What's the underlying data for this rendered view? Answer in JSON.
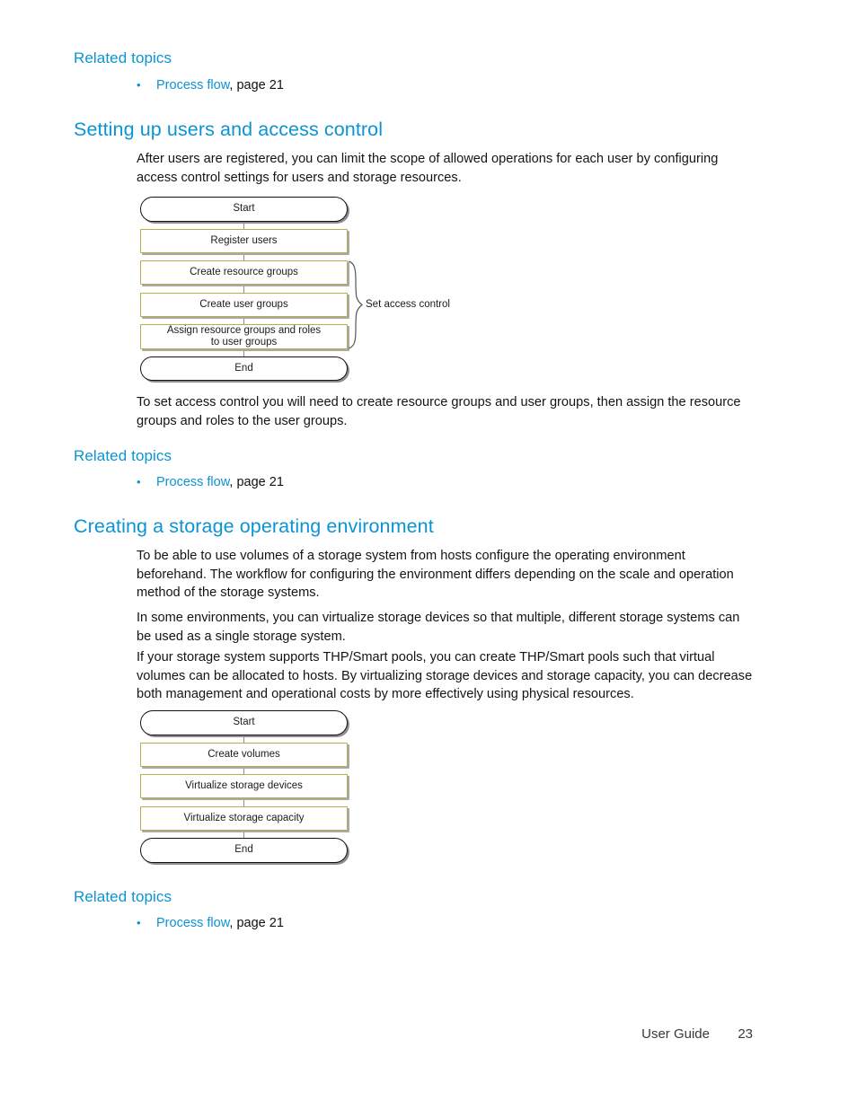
{
  "page": {
    "footer_label": "User Guide",
    "page_number": "23",
    "accent_color": "#0b94d4",
    "step_border_color": "#b5ae49",
    "terminator_border_color": "#111111"
  },
  "related_topics_1": {
    "heading": "Related topics",
    "bullet_marker": "•",
    "link_text": "Process flow",
    "suffix_text": ", page 21"
  },
  "section_access_control": {
    "heading": "Setting up users and access control",
    "intro_paragraph": "After users are registered, you can limit the scope of allowed operations for each user by configuring access control settings for users and storage resources.",
    "closing_paragraph": "To set access control you will need to create resource groups and user groups, then assign the resource groups and roles to the user groups.",
    "diagram": {
      "nodes": [
        {
          "id": "start",
          "label": "Start",
          "type": "terminator"
        },
        {
          "id": "register-users",
          "label": "Register users",
          "type": "step"
        },
        {
          "id": "create-resource-groups",
          "label": "Create resource groups",
          "type": "step"
        },
        {
          "id": "create-user-groups",
          "label": "Create user groups",
          "type": "step"
        },
        {
          "id": "assign-resource-groups",
          "label": "Assign resource groups and roles\nto user groups",
          "type": "step"
        },
        {
          "id": "end",
          "label": "End",
          "type": "terminator"
        }
      ],
      "bracket_label": "Set access control"
    }
  },
  "related_topics_2": {
    "heading": "Related topics",
    "bullet_marker": "•",
    "link_text": "Process flow",
    "suffix_text": ", page 21"
  },
  "section_storage_env": {
    "heading": "Creating a storage operating environment",
    "paragraph_1": "To be able to use volumes of a storage system from hosts configure the operating environment beforehand. The workflow for configuring the environment differs depending on the scale and operation method of the storage systems.",
    "paragraph_2": "In some environments, you can virtualize storage devices so that multiple, different storage systems can be used as a single storage system.",
    "paragraph_3": "If your storage system supports THP/Smart pools, you can create THP/Smart pools such that virtual volumes can be allocated to hosts. By virtualizing storage devices and storage capacity, you can decrease both management and operational costs by more effectively using physical resources.",
    "diagram": {
      "nodes": [
        {
          "id": "start",
          "label": "Start",
          "type": "terminator"
        },
        {
          "id": "create-volumes",
          "label": "Create volumes",
          "type": "step"
        },
        {
          "id": "virtualize-storage-devices",
          "label": "Virtualize storage devices",
          "type": "step"
        },
        {
          "id": "virtualize-storage-capacity",
          "label": "Virtualize storage capacity",
          "type": "step"
        },
        {
          "id": "end",
          "label": "End",
          "type": "terminator"
        }
      ]
    }
  },
  "related_topics_3": {
    "heading": "Related topics",
    "bullet_marker": "•",
    "link_text": "Process flow",
    "suffix_text": ", page 21"
  }
}
